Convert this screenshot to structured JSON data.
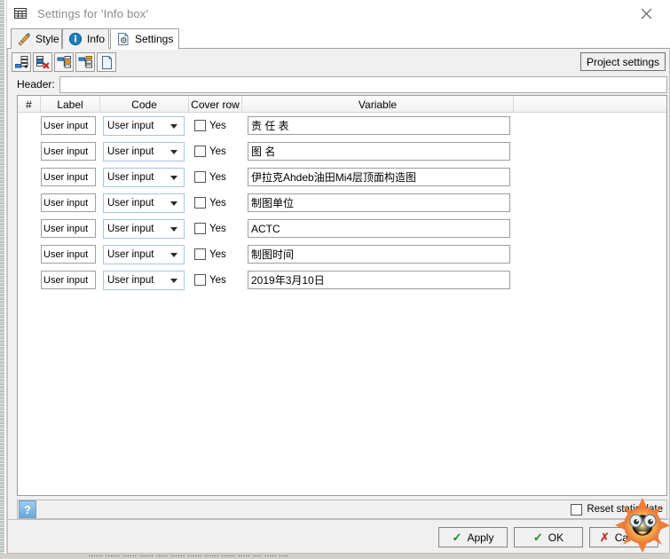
{
  "window": {
    "title": "Settings for 'Info box'",
    "title_icon": "grid-window-icon",
    "close_icon": "close-icon"
  },
  "tabs": [
    {
      "label": "Style",
      "icon": "paintbrush-icon",
      "active": false
    },
    {
      "label": "Info",
      "icon": "info-circle-icon",
      "active": false
    },
    {
      "label": "Settings",
      "icon": "gear-page-icon",
      "active": true
    }
  ],
  "toolbar": {
    "buttons": [
      {
        "icon": "add-row-icon",
        "tip": "Add row"
      },
      {
        "icon": "delete-row-icon",
        "tip": "Delete row"
      },
      {
        "icon": "move-up-icon",
        "tip": "Move up"
      },
      {
        "icon": "move-down-icon",
        "tip": "Move down"
      },
      {
        "icon": "new-page-icon",
        "tip": "New"
      }
    ],
    "project_settings_label": "Project settings"
  },
  "header_field": {
    "label": "Header:",
    "value": "",
    "placeholder": ""
  },
  "grid": {
    "columns": [
      "#",
      "Label",
      "Code",
      "Cover row",
      "Variable",
      ""
    ],
    "rows": [
      {
        "label": "User input",
        "code": "User input",
        "cover_row": false,
        "cover_label": "Yes",
        "variable": "责  任  表"
      },
      {
        "label": "User input",
        "code": "User input",
        "cover_row": false,
        "cover_label": "Yes",
        "variable": "图   名"
      },
      {
        "label": "User input",
        "code": "User input",
        "cover_row": false,
        "cover_label": "Yes",
        "variable": "伊拉克Ahdeb油田Mi4层顶面构造图"
      },
      {
        "label": "User input",
        "code": "User input",
        "cover_row": false,
        "cover_label": "Yes",
        "variable": "制图单位"
      },
      {
        "label": "User input",
        "code": "User input",
        "cover_row": false,
        "cover_label": "Yes",
        "variable": "ACTC"
      },
      {
        "label": "User input",
        "code": "User input",
        "cover_row": false,
        "cover_label": "Yes",
        "variable": "制图时间"
      },
      {
        "label": "User input",
        "code": "User input",
        "cover_row": false,
        "cover_label": "Yes",
        "variable": "2019年3月10日"
      }
    ]
  },
  "bottom_bar": {
    "help_label": "?",
    "help_icon": "help-icon",
    "reset_static_date_label": "Reset static date",
    "reset_static_date_checked": false
  },
  "footer": {
    "apply_label": "Apply",
    "ok_label": "OK",
    "cancel_label": "Cancel",
    "apply_icon": "check-icon",
    "ok_icon": "check-icon",
    "cancel_icon": "x-icon"
  },
  "overlay": {
    "icon": "sun-cartoon-icon"
  },
  "colors": {
    "accent_blue": "#1a7fc1",
    "ok_green": "#1f8a28",
    "cancel_red": "#c0392b",
    "sun_orange": "#f0902c",
    "window_bg": "#f0f0f0"
  }
}
